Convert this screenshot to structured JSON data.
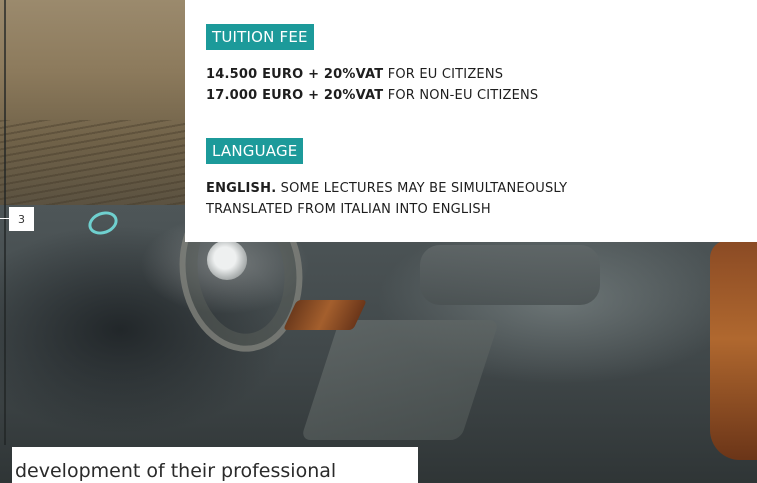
{
  "tuition": {
    "title": "TUITION FEE",
    "lines": [
      {
        "bold": "14.500 EURO + 20%VAT",
        "rest": " FOR EU CITIZENS"
      },
      {
        "bold": "17.000 EURO + 20%VAT",
        "rest": " FOR NON-EU CITIZENS"
      }
    ]
  },
  "language": {
    "title": "LANGUAGE",
    "line1_bold": "ENGLISH.",
    "line1_rest": " SOME LECTURES MAY BE SIMULTANEOUSLY",
    "line2": "TRANSLATED FROM ITALIAN INTO ENGLISH"
  },
  "page_number": "3",
  "bottom_text": "development of their professional",
  "colors": {
    "accent": "#1c9a9a",
    "panel_bg": "#ffffff",
    "text": "#1e1e1e"
  }
}
